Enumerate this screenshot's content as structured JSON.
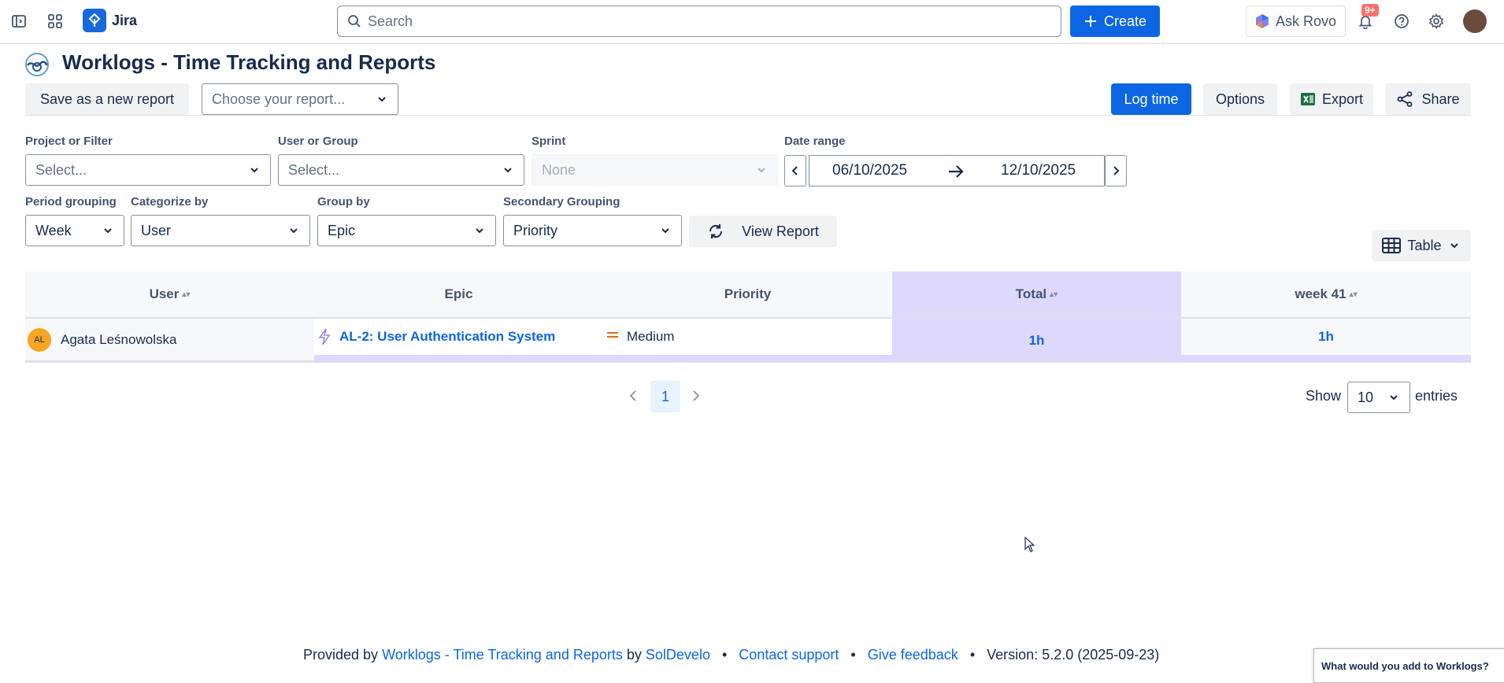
{
  "topbar": {
    "app_name": "Jira",
    "search_placeholder": "Search",
    "create_label": "Create",
    "ask_rovo_label": "Ask Rovo",
    "notifications_badge": "9+"
  },
  "page": {
    "title": "Worklogs - Time Tracking and Reports",
    "save_report_label": "Save as a new report",
    "choose_report_placeholder": "Choose your report...",
    "log_time_label": "Log time",
    "options_label": "Options",
    "export_label": "Export",
    "share_label": "Share"
  },
  "filters": {
    "project_label": "Project or Filter",
    "project_placeholder": "Select...",
    "user_label": "User or Group",
    "user_placeholder": "Select...",
    "sprint_label": "Sprint",
    "sprint_value": "None",
    "date_label": "Date range",
    "date_from": "06/10/2025",
    "date_to": "12/10/2025",
    "period_label": "Period grouping",
    "period_value": "Week",
    "categorize_label": "Categorize by",
    "categorize_value": "User",
    "groupby_label": "Group by",
    "groupby_value": "Epic",
    "secondary_label": "Secondary Grouping",
    "secondary_value": "Priority",
    "view_report_label": "View Report"
  },
  "view_toggle": {
    "label": "Table"
  },
  "table": {
    "headers": [
      "User",
      "Epic",
      "Priority",
      "Total",
      "week 41"
    ],
    "rows": [
      {
        "user_initials": "AL",
        "user": "Agata Leśnowolska",
        "epic": "AL-2: User Authentication System",
        "priority": "Medium",
        "total": "1h",
        "week41": "1h"
      }
    ]
  },
  "pagination": {
    "current_page": "1",
    "show_label": "Show",
    "entries_value": "10",
    "entries_label": "entries"
  },
  "footer": {
    "provided_by": "Provided by",
    "app_link": "Worklogs - Time Tracking and Reports",
    "by": "by",
    "vendor_link": "SolDevelo",
    "contact_link": "Contact support",
    "feedback_link": "Give feedback",
    "version": "Version: 5.2.0 (2025-09-23)"
  },
  "feedback_widget": {
    "text": "What would you add to Worklogs?"
  },
  "colors": {
    "accent": "#0c66e4",
    "highlight_col": "#dfd8fd",
    "avatar": "#f5a623"
  }
}
